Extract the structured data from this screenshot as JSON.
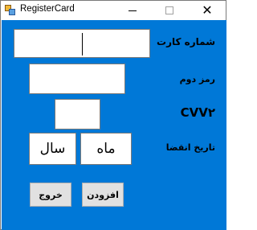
{
  "window": {
    "title": "RegisterCard",
    "controls": {
      "minimize": "",
      "maximize": "",
      "close": "✕"
    }
  },
  "form": {
    "card_number_label": "شماره کارت",
    "card_number_value": "",
    "second_pin_label": "رمز دوم",
    "second_pin_value": "",
    "cvv2_label": "CVV۲",
    "cvv2_value": "",
    "expiry_label": "تاریخ انقضا",
    "expiry_month": "ماه",
    "expiry_year": "سال"
  },
  "buttons": {
    "exit": "خروج",
    "add": "افزودن"
  },
  "colors": {
    "client_bg": "#0078d7",
    "button_bg": "#e1e1e1"
  }
}
